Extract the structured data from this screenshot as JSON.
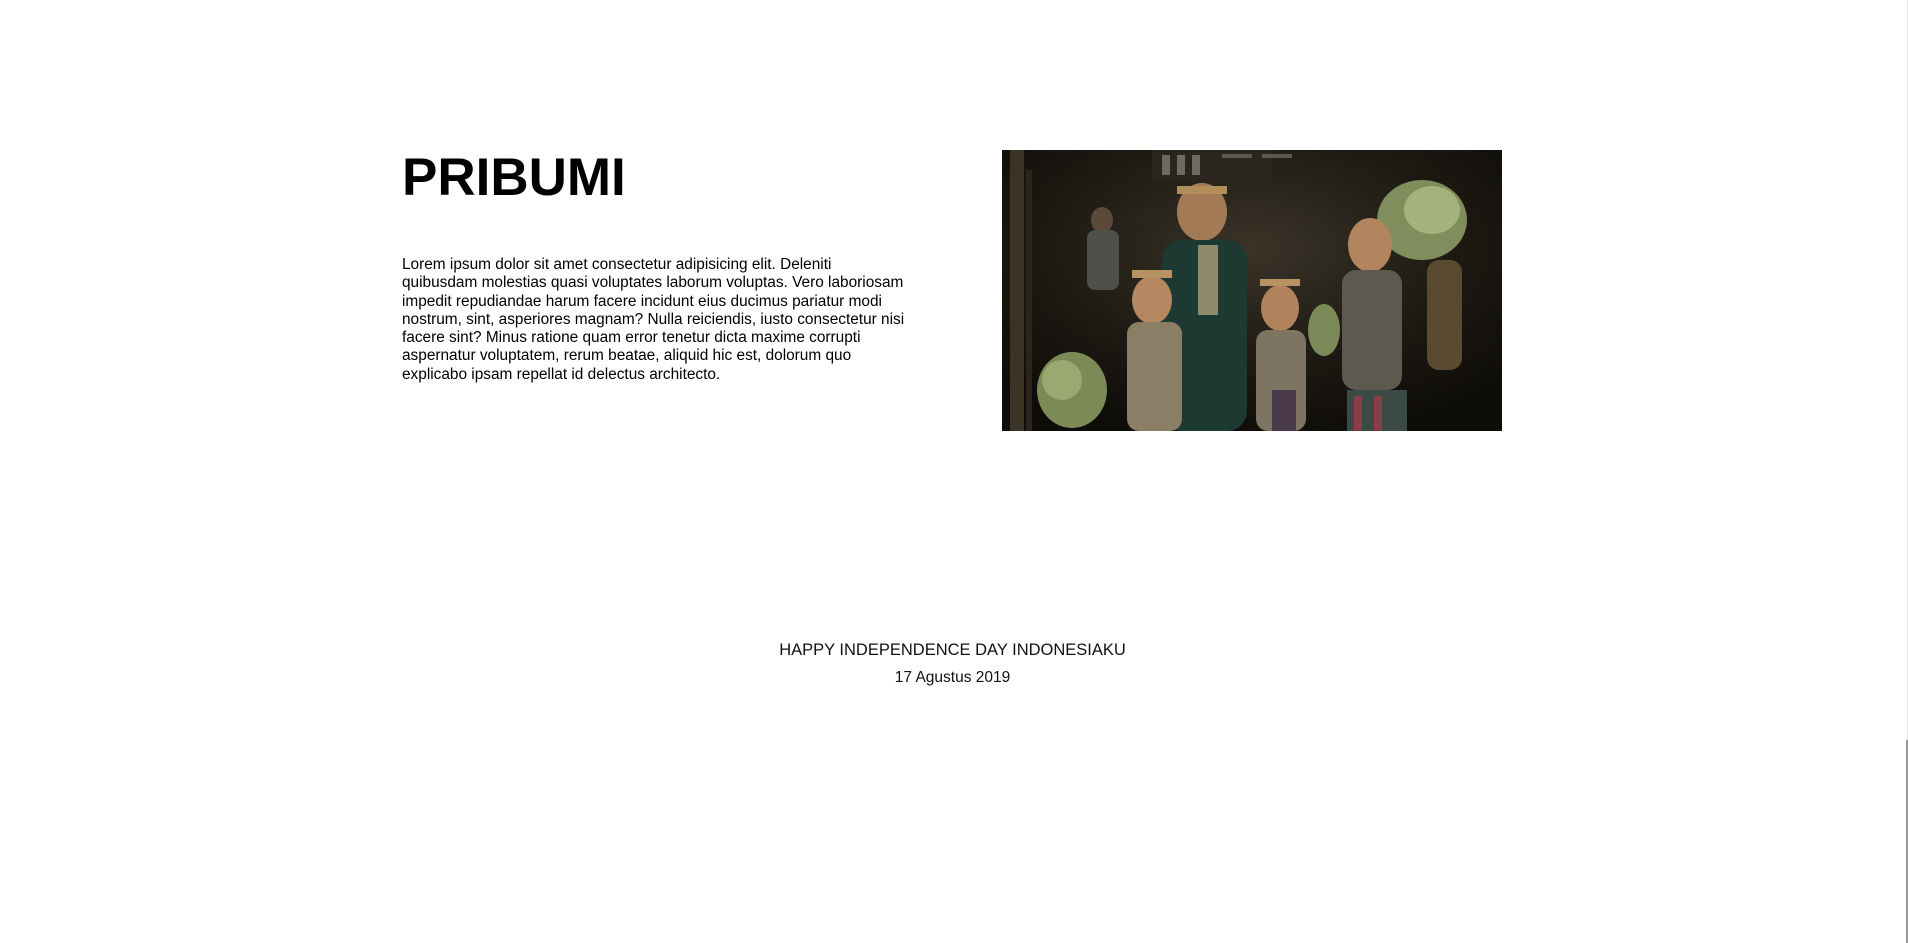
{
  "hero": {
    "title": "PRIBUMI",
    "body": "Lorem ipsum dolor sit amet consectetur adipisicing elit. Deleniti quibusdam molestias quasi voluptates laborum voluptas. Vero laboriosam impedit repudiandae harum facere incidunt eius ducimus pariatur modi nostrum, sint, asperiores magnam? Nulla reiciendis, iusto consectetur nisi facere sint? Minus ratione quam error tenetur dicta maxime corrupti aspernatur voluptatem, rerum beatae, aliquid hic est, dolorum quo explicabo ipsam repellat id delectus architecto.",
    "photo_icon": "photo-of-family-carrying-bananas"
  },
  "footer": {
    "line1": "HAPPY INDEPENDENCE DAY INDONESIAKU",
    "line2": "17 Agustus 2019"
  },
  "colors": {
    "background": "#ffffff",
    "text": "#000000",
    "photo_dark": "#14110c"
  }
}
